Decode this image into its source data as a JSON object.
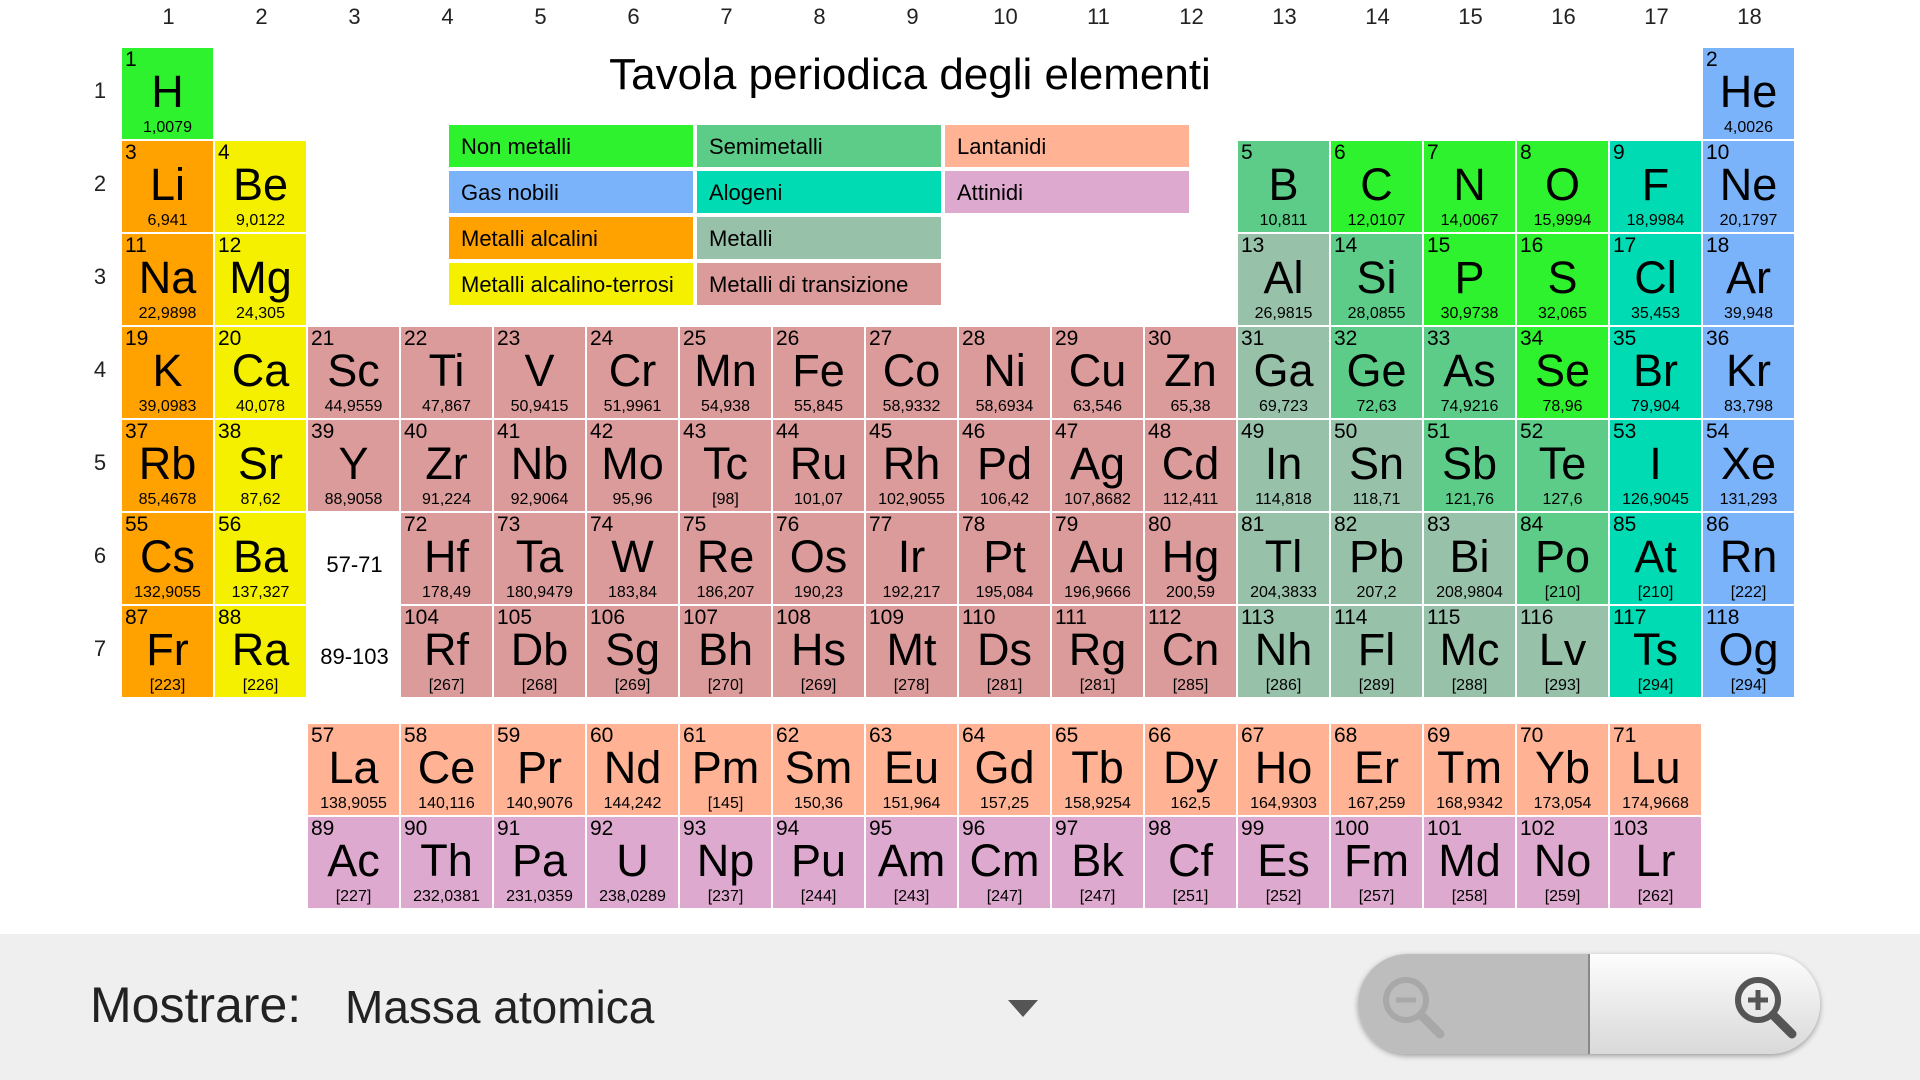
{
  "title": "Tavola periodica degli elementi",
  "group_numbers": [
    "1",
    "2",
    "3",
    "4",
    "5",
    "6",
    "7",
    "8",
    "9",
    "10",
    "11",
    "12",
    "13",
    "14",
    "15",
    "16",
    "17",
    "18"
  ],
  "period_numbers": [
    "1",
    "2",
    "3",
    "4",
    "5",
    "6",
    "7"
  ],
  "range_labels": {
    "lanthanides": "57-71",
    "actinides": "89-103"
  },
  "colors": {
    "nonmetal": "#2ef22e",
    "noble": "#7ab3fa",
    "alkali": "#ffa200",
    "alkaline": "#f4f000",
    "metalloid": "#5ccc88",
    "halogen": "#00dbb3",
    "metal": "#98c1aa",
    "transition": "#dc9b9b",
    "lanthanide": "#ffb294",
    "actinide": "#dea9cf"
  },
  "legend": [
    {
      "label": "Non metalli",
      "cat": "nonmetal"
    },
    {
      "label": "Semimetalli",
      "cat": "metalloid"
    },
    {
      "label": "Lantanidi",
      "cat": "lanthanide"
    },
    {
      "label": "Gas nobili",
      "cat": "noble"
    },
    {
      "label": "Alogeni",
      "cat": "halogen"
    },
    {
      "label": "Attinidi",
      "cat": "actinide"
    },
    {
      "label": "Metalli alcalini",
      "cat": "alkali"
    },
    {
      "label": "Metalli",
      "cat": "metal"
    },
    {
      "label": "Metalli alcalino-terrosi",
      "cat": "alkaline"
    },
    {
      "label": "Metalli di transizione",
      "cat": "transition"
    }
  ],
  "elements": [
    {
      "n": "1",
      "s": "H",
      "m": "1,0079",
      "g": 1,
      "p": 1,
      "c": "nonmetal"
    },
    {
      "n": "2",
      "s": "He",
      "m": "4,0026",
      "g": 18,
      "p": 1,
      "c": "noble"
    },
    {
      "n": "3",
      "s": "Li",
      "m": "6,941",
      "g": 1,
      "p": 2,
      "c": "alkali"
    },
    {
      "n": "4",
      "s": "Be",
      "m": "9,0122",
      "g": 2,
      "p": 2,
      "c": "alkaline"
    },
    {
      "n": "5",
      "s": "B",
      "m": "10,811",
      "g": 13,
      "p": 2,
      "c": "metalloid"
    },
    {
      "n": "6",
      "s": "C",
      "m": "12,0107",
      "g": 14,
      "p": 2,
      "c": "nonmetal"
    },
    {
      "n": "7",
      "s": "N",
      "m": "14,0067",
      "g": 15,
      "p": 2,
      "c": "nonmetal"
    },
    {
      "n": "8",
      "s": "O",
      "m": "15,9994",
      "g": 16,
      "p": 2,
      "c": "nonmetal"
    },
    {
      "n": "9",
      "s": "F",
      "m": "18,9984",
      "g": 17,
      "p": 2,
      "c": "halogen"
    },
    {
      "n": "10",
      "s": "Ne",
      "m": "20,1797",
      "g": 18,
      "p": 2,
      "c": "noble"
    },
    {
      "n": "11",
      "s": "Na",
      "m": "22,9898",
      "g": 1,
      "p": 3,
      "c": "alkali"
    },
    {
      "n": "12",
      "s": "Mg",
      "m": "24,305",
      "g": 2,
      "p": 3,
      "c": "alkaline"
    },
    {
      "n": "13",
      "s": "Al",
      "m": "26,9815",
      "g": 13,
      "p": 3,
      "c": "metal"
    },
    {
      "n": "14",
      "s": "Si",
      "m": "28,0855",
      "g": 14,
      "p": 3,
      "c": "metalloid"
    },
    {
      "n": "15",
      "s": "P",
      "m": "30,9738",
      "g": 15,
      "p": 3,
      "c": "nonmetal"
    },
    {
      "n": "16",
      "s": "S",
      "m": "32,065",
      "g": 16,
      "p": 3,
      "c": "nonmetal"
    },
    {
      "n": "17",
      "s": "Cl",
      "m": "35,453",
      "g": 17,
      "p": 3,
      "c": "halogen"
    },
    {
      "n": "18",
      "s": "Ar",
      "m": "39,948",
      "g": 18,
      "p": 3,
      "c": "noble"
    },
    {
      "n": "19",
      "s": "K",
      "m": "39,0983",
      "g": 1,
      "p": 4,
      "c": "alkali"
    },
    {
      "n": "20",
      "s": "Ca",
      "m": "40,078",
      "g": 2,
      "p": 4,
      "c": "alkaline"
    },
    {
      "n": "21",
      "s": "Sc",
      "m": "44,9559",
      "g": 3,
      "p": 4,
      "c": "transition"
    },
    {
      "n": "22",
      "s": "Ti",
      "m": "47,867",
      "g": 4,
      "p": 4,
      "c": "transition"
    },
    {
      "n": "23",
      "s": "V",
      "m": "50,9415",
      "g": 5,
      "p": 4,
      "c": "transition"
    },
    {
      "n": "24",
      "s": "Cr",
      "m": "51,9961",
      "g": 6,
      "p": 4,
      "c": "transition"
    },
    {
      "n": "25",
      "s": "Mn",
      "m": "54,938",
      "g": 7,
      "p": 4,
      "c": "transition"
    },
    {
      "n": "26",
      "s": "Fe",
      "m": "55,845",
      "g": 8,
      "p": 4,
      "c": "transition"
    },
    {
      "n": "27",
      "s": "Co",
      "m": "58,9332",
      "g": 9,
      "p": 4,
      "c": "transition"
    },
    {
      "n": "28",
      "s": "Ni",
      "m": "58,6934",
      "g": 10,
      "p": 4,
      "c": "transition"
    },
    {
      "n": "29",
      "s": "Cu",
      "m": "63,546",
      "g": 11,
      "p": 4,
      "c": "transition"
    },
    {
      "n": "30",
      "s": "Zn",
      "m": "65,38",
      "g": 12,
      "p": 4,
      "c": "transition"
    },
    {
      "n": "31",
      "s": "Ga",
      "m": "69,723",
      "g": 13,
      "p": 4,
      "c": "metal"
    },
    {
      "n": "32",
      "s": "Ge",
      "m": "72,63",
      "g": 14,
      "p": 4,
      "c": "metalloid"
    },
    {
      "n": "33",
      "s": "As",
      "m": "74,9216",
      "g": 15,
      "p": 4,
      "c": "metalloid"
    },
    {
      "n": "34",
      "s": "Se",
      "m": "78,96",
      "g": 16,
      "p": 4,
      "c": "nonmetal"
    },
    {
      "n": "35",
      "s": "Br",
      "m": "79,904",
      "g": 17,
      "p": 4,
      "c": "halogen"
    },
    {
      "n": "36",
      "s": "Kr",
      "m": "83,798",
      "g": 18,
      "p": 4,
      "c": "noble"
    },
    {
      "n": "37",
      "s": "Rb",
      "m": "85,4678",
      "g": 1,
      "p": 5,
      "c": "alkali"
    },
    {
      "n": "38",
      "s": "Sr",
      "m": "87,62",
      "g": 2,
      "p": 5,
      "c": "alkaline"
    },
    {
      "n": "39",
      "s": "Y",
      "m": "88,9058",
      "g": 3,
      "p": 5,
      "c": "transition"
    },
    {
      "n": "40",
      "s": "Zr",
      "m": "91,224",
      "g": 4,
      "p": 5,
      "c": "transition"
    },
    {
      "n": "41",
      "s": "Nb",
      "m": "92,9064",
      "g": 5,
      "p": 5,
      "c": "transition"
    },
    {
      "n": "42",
      "s": "Mo",
      "m": "95,96",
      "g": 6,
      "p": 5,
      "c": "transition"
    },
    {
      "n": "43",
      "s": "Tc",
      "m": "[98]",
      "g": 7,
      "p": 5,
      "c": "transition"
    },
    {
      "n": "44",
      "s": "Ru",
      "m": "101,07",
      "g": 8,
      "p": 5,
      "c": "transition"
    },
    {
      "n": "45",
      "s": "Rh",
      "m": "102,9055",
      "g": 9,
      "p": 5,
      "c": "transition"
    },
    {
      "n": "46",
      "s": "Pd",
      "m": "106,42",
      "g": 10,
      "p": 5,
      "c": "transition"
    },
    {
      "n": "47",
      "s": "Ag",
      "m": "107,8682",
      "g": 11,
      "p": 5,
      "c": "transition"
    },
    {
      "n": "48",
      "s": "Cd",
      "m": "112,411",
      "g": 12,
      "p": 5,
      "c": "transition"
    },
    {
      "n": "49",
      "s": "In",
      "m": "114,818",
      "g": 13,
      "p": 5,
      "c": "metal"
    },
    {
      "n": "50",
      "s": "Sn",
      "m": "118,71",
      "g": 14,
      "p": 5,
      "c": "metal"
    },
    {
      "n": "51",
      "s": "Sb",
      "m": "121,76",
      "g": 15,
      "p": 5,
      "c": "metalloid"
    },
    {
      "n": "52",
      "s": "Te",
      "m": "127,6",
      "g": 16,
      "p": 5,
      "c": "metalloid"
    },
    {
      "n": "53",
      "s": "I",
      "m": "126,9045",
      "g": 17,
      "p": 5,
      "c": "halogen"
    },
    {
      "n": "54",
      "s": "Xe",
      "m": "131,293",
      "g": 18,
      "p": 5,
      "c": "noble"
    },
    {
      "n": "55",
      "s": "Cs",
      "m": "132,9055",
      "g": 1,
      "p": 6,
      "c": "alkali"
    },
    {
      "n": "56",
      "s": "Ba",
      "m": "137,327",
      "g": 2,
      "p": 6,
      "c": "alkaline"
    },
    {
      "n": "72",
      "s": "Hf",
      "m": "178,49",
      "g": 4,
      "p": 6,
      "c": "transition"
    },
    {
      "n": "73",
      "s": "Ta",
      "m": "180,9479",
      "g": 5,
      "p": 6,
      "c": "transition"
    },
    {
      "n": "74",
      "s": "W",
      "m": "183,84",
      "g": 6,
      "p": 6,
      "c": "transition"
    },
    {
      "n": "75",
      "s": "Re",
      "m": "186,207",
      "g": 7,
      "p": 6,
      "c": "transition"
    },
    {
      "n": "76",
      "s": "Os",
      "m": "190,23",
      "g": 8,
      "p": 6,
      "c": "transition"
    },
    {
      "n": "77",
      "s": "Ir",
      "m": "192,217",
      "g": 9,
      "p": 6,
      "c": "transition"
    },
    {
      "n": "78",
      "s": "Pt",
      "m": "195,084",
      "g": 10,
      "p": 6,
      "c": "transition"
    },
    {
      "n": "79",
      "s": "Au",
      "m": "196,9666",
      "g": 11,
      "p": 6,
      "c": "transition"
    },
    {
      "n": "80",
      "s": "Hg",
      "m": "200,59",
      "g": 12,
      "p": 6,
      "c": "transition"
    },
    {
      "n": "81",
      "s": "Tl",
      "m": "204,3833",
      "g": 13,
      "p": 6,
      "c": "metal"
    },
    {
      "n": "82",
      "s": "Pb",
      "m": "207,2",
      "g": 14,
      "p": 6,
      "c": "metal"
    },
    {
      "n": "83",
      "s": "Bi",
      "m": "208,9804",
      "g": 15,
      "p": 6,
      "c": "metal"
    },
    {
      "n": "84",
      "s": "Po",
      "m": "[210]",
      "g": 16,
      "p": 6,
      "c": "metalloid"
    },
    {
      "n": "85",
      "s": "At",
      "m": "[210]",
      "g": 17,
      "p": 6,
      "c": "halogen"
    },
    {
      "n": "86",
      "s": "Rn",
      "m": "[222]",
      "g": 18,
      "p": 6,
      "c": "noble"
    },
    {
      "n": "87",
      "s": "Fr",
      "m": "[223]",
      "g": 1,
      "p": 7,
      "c": "alkali"
    },
    {
      "n": "88",
      "s": "Ra",
      "m": "[226]",
      "g": 2,
      "p": 7,
      "c": "alkaline"
    },
    {
      "n": "104",
      "s": "Rf",
      "m": "[267]",
      "g": 4,
      "p": 7,
      "c": "transition"
    },
    {
      "n": "105",
      "s": "Db",
      "m": "[268]",
      "g": 5,
      "p": 7,
      "c": "transition"
    },
    {
      "n": "106",
      "s": "Sg",
      "m": "[269]",
      "g": 6,
      "p": 7,
      "c": "transition"
    },
    {
      "n": "107",
      "s": "Bh",
      "m": "[270]",
      "g": 7,
      "p": 7,
      "c": "transition"
    },
    {
      "n": "108",
      "s": "Hs",
      "m": "[269]",
      "g": 8,
      "p": 7,
      "c": "transition"
    },
    {
      "n": "109",
      "s": "Mt",
      "m": "[278]",
      "g": 9,
      "p": 7,
      "c": "transition"
    },
    {
      "n": "110",
      "s": "Ds",
      "m": "[281]",
      "g": 10,
      "p": 7,
      "c": "transition"
    },
    {
      "n": "111",
      "s": "Rg",
      "m": "[281]",
      "g": 11,
      "p": 7,
      "c": "transition"
    },
    {
      "n": "112",
      "s": "Cn",
      "m": "[285]",
      "g": 12,
      "p": 7,
      "c": "transition"
    },
    {
      "n": "113",
      "s": "Nh",
      "m": "[286]",
      "g": 13,
      "p": 7,
      "c": "metal"
    },
    {
      "n": "114",
      "s": "Fl",
      "m": "[289]",
      "g": 14,
      "p": 7,
      "c": "metal"
    },
    {
      "n": "115",
      "s": "Mc",
      "m": "[288]",
      "g": 15,
      "p": 7,
      "c": "metal"
    },
    {
      "n": "116",
      "s": "Lv",
      "m": "[293]",
      "g": 16,
      "p": 7,
      "c": "metal"
    },
    {
      "n": "117",
      "s": "Ts",
      "m": "[294]",
      "g": 17,
      "p": 7,
      "c": "halogen"
    },
    {
      "n": "118",
      "s": "Og",
      "m": "[294]",
      "g": 18,
      "p": 7,
      "c": "noble"
    },
    {
      "n": "57",
      "s": "La",
      "m": "138,9055",
      "g": 3,
      "p": 8,
      "c": "lanthanide"
    },
    {
      "n": "58",
      "s": "Ce",
      "m": "140,116",
      "g": 4,
      "p": 8,
      "c": "lanthanide"
    },
    {
      "n": "59",
      "s": "Pr",
      "m": "140,9076",
      "g": 5,
      "p": 8,
      "c": "lanthanide"
    },
    {
      "n": "60",
      "s": "Nd",
      "m": "144,242",
      "g": 6,
      "p": 8,
      "c": "lanthanide"
    },
    {
      "n": "61",
      "s": "Pm",
      "m": "[145]",
      "g": 7,
      "p": 8,
      "c": "lanthanide"
    },
    {
      "n": "62",
      "s": "Sm",
      "m": "150,36",
      "g": 8,
      "p": 8,
      "c": "lanthanide"
    },
    {
      "n": "63",
      "s": "Eu",
      "m": "151,964",
      "g": 9,
      "p": 8,
      "c": "lanthanide"
    },
    {
      "n": "64",
      "s": "Gd",
      "m": "157,25",
      "g": 10,
      "p": 8,
      "c": "lanthanide"
    },
    {
      "n": "65",
      "s": "Tb",
      "m": "158,9254",
      "g": 11,
      "p": 8,
      "c": "lanthanide"
    },
    {
      "n": "66",
      "s": "Dy",
      "m": "162,5",
      "g": 12,
      "p": 8,
      "c": "lanthanide"
    },
    {
      "n": "67",
      "s": "Ho",
      "m": "164,9303",
      "g": 13,
      "p": 8,
      "c": "lanthanide"
    },
    {
      "n": "68",
      "s": "Er",
      "m": "167,259",
      "g": 14,
      "p": 8,
      "c": "lanthanide"
    },
    {
      "n": "69",
      "s": "Tm",
      "m": "168,9342",
      "g": 15,
      "p": 8,
      "c": "lanthanide"
    },
    {
      "n": "70",
      "s": "Yb",
      "m": "173,054",
      "g": 16,
      "p": 8,
      "c": "lanthanide"
    },
    {
      "n": "71",
      "s": "Lu",
      "m": "174,9668",
      "g": 17,
      "p": 8,
      "c": "lanthanide"
    },
    {
      "n": "89",
      "s": "Ac",
      "m": "[227]",
      "g": 3,
      "p": 9,
      "c": "actinide"
    },
    {
      "n": "90",
      "s": "Th",
      "m": "232,0381",
      "g": 4,
      "p": 9,
      "c": "actinide"
    },
    {
      "n": "91",
      "s": "Pa",
      "m": "231,0359",
      "g": 5,
      "p": 9,
      "c": "actinide"
    },
    {
      "n": "92",
      "s": "U",
      "m": "238,0289",
      "g": 6,
      "p": 9,
      "c": "actinide"
    },
    {
      "n": "93",
      "s": "Np",
      "m": "[237]",
      "g": 7,
      "p": 9,
      "c": "actinide"
    },
    {
      "n": "94",
      "s": "Pu",
      "m": "[244]",
      "g": 8,
      "p": 9,
      "c": "actinide"
    },
    {
      "n": "95",
      "s": "Am",
      "m": "[243]",
      "g": 9,
      "p": 9,
      "c": "actinide"
    },
    {
      "n": "96",
      "s": "Cm",
      "m": "[247]",
      "g": 10,
      "p": 9,
      "c": "actinide"
    },
    {
      "n": "97",
      "s": "Bk",
      "m": "[247]",
      "g": 11,
      "p": 9,
      "c": "actinide"
    },
    {
      "n": "98",
      "s": "Cf",
      "m": "[251]",
      "g": 12,
      "p": 9,
      "c": "actinide"
    },
    {
      "n": "99",
      "s": "Es",
      "m": "[252]",
      "g": 13,
      "p": 9,
      "c": "actinide"
    },
    {
      "n": "100",
      "s": "Fm",
      "m": "[257]",
      "g": 14,
      "p": 9,
      "c": "actinide"
    },
    {
      "n": "101",
      "s": "Md",
      "m": "[258]",
      "g": 15,
      "p": 9,
      "c": "actinide"
    },
    {
      "n": "102",
      "s": "No",
      "m": "[259]",
      "g": 16,
      "p": 9,
      "c": "actinide"
    },
    {
      "n": "103",
      "s": "Lr",
      "m": "[262]",
      "g": 17,
      "p": 9,
      "c": "actinide"
    }
  ],
  "bottom_bar": {
    "show_label": "Mostrare:",
    "show_value": "Massa atomica",
    "dropdown_icon": "dropdown-arrow-icon",
    "zoom_out_icon": "zoom-out-icon",
    "zoom_in_icon": "zoom-in-icon"
  }
}
